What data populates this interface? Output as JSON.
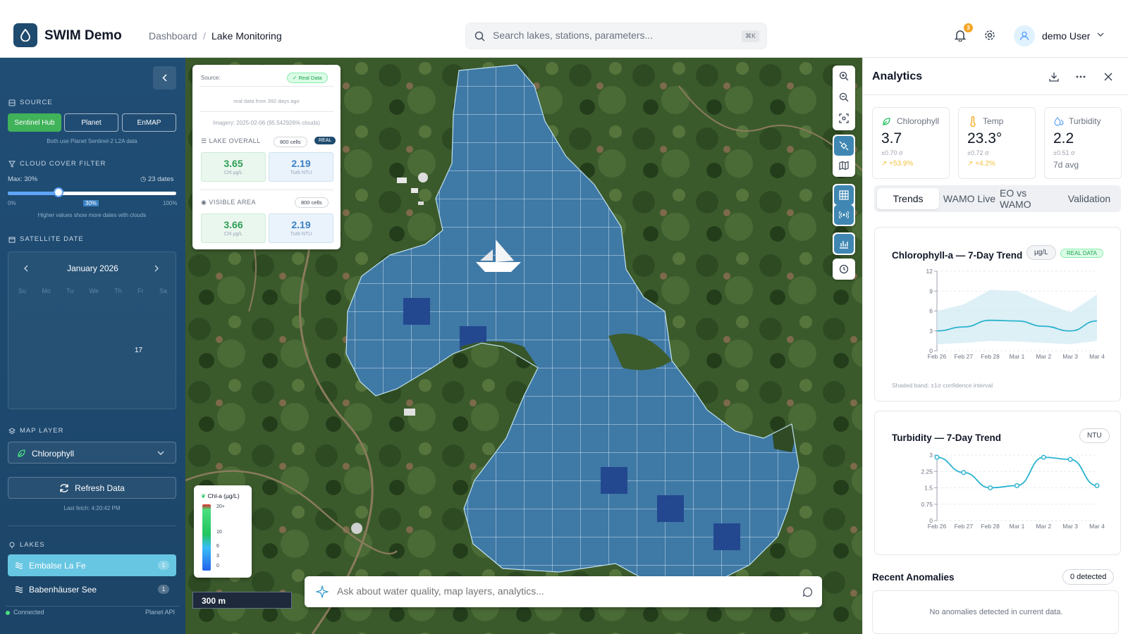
{
  "header": {
    "app_title": "SWIM Demo",
    "breadcrumb": [
      "Dashboard",
      "/",
      "Lake Monitoring"
    ],
    "search_placeholder": "Search lakes, stations, parameters...",
    "search_shortcut": "⌘K",
    "notification_count": "3",
    "user_name": "demo User"
  },
  "sidebar": {
    "source_title": "SOURCE",
    "sources": [
      "Sentinel Hub",
      "Planet",
      "EnMAP"
    ],
    "source_note": "Both use Planet Sentinel-2 L2A data",
    "cloud_title": "CLOUD COVER FILTER",
    "cloud_max": "Max: 30%",
    "cloud_dates": "23 dates",
    "cloud_value": 30,
    "slider_min": "0%",
    "slider_mid": "30%",
    "slider_max": "100%",
    "cloud_hint": "Higher values show more dates with clouds",
    "sat_title": "SATELLITE DATE",
    "month": "January 2026",
    "weekdays": [
      "Su",
      "Mo",
      "Tu",
      "We",
      "Th",
      "Fr",
      "Sa"
    ],
    "highlight_day": "17",
    "layer_title": "MAP LAYER",
    "layer_value": "Chlorophyll",
    "refresh_label": "Refresh Data",
    "last_fetch": "Last fetch: 4:20:42 PM",
    "lakes_title": "LAKES",
    "lakes": [
      {
        "name": "Embalse La Fe",
        "count": "1"
      },
      {
        "name": "Babenhäuser See",
        "count": "1"
      }
    ],
    "status": "Connected",
    "api": "Planet API"
  },
  "map": {
    "source_label": "Source:",
    "real_badge": "✓ Real Data",
    "real_note": "real data from 392 days ago",
    "imagery": "Imagery: 2025-02-06 (95.542926% clouds)",
    "lake_overall": "LAKE OVERALL",
    "cells": "800 cells",
    "real_tag": "REAL",
    "overall_chl": "3.65",
    "overall_turb": "2.19",
    "chl_unit": "Chl µg/L",
    "turb_unit": "Turb NTU",
    "visible_area": "VISIBLE AREA",
    "visible_cells": "800 cells",
    "visible_chl": "3.66",
    "visible_turb": "2.19",
    "legend_title": "Chl-a (µg/L)",
    "legend_ticks": [
      "20+",
      "10",
      "6",
      "3",
      "0"
    ],
    "scale": "300 m",
    "ask_placeholder": "Ask about water quality, map layers, analytics..."
  },
  "analytics": {
    "title": "Analytics",
    "kpis": [
      {
        "label": "Chlorophyll",
        "value": "3.7",
        "sigma": "±0.70 σ",
        "delta": "↗ +53.9%"
      },
      {
        "label": "Temp",
        "value": "23.3°",
        "sigma": "±0.72 σ",
        "delta": "↗ +4.2%"
      },
      {
        "label": "Turbidity",
        "value": "2.2",
        "sigma": "±0.51 σ",
        "delta": "7d avg"
      }
    ],
    "tabs": [
      "Trends",
      "WAMO Live",
      "EO vs WAMO",
      "Validation"
    ],
    "chl_title": "Chlorophyll-a — 7-Day Trend",
    "chl_unit": "µg/L",
    "chl_badge": "REAL DATA",
    "chl_footnote": "Shaded band: ±1σ confidence interval",
    "turb_title": "Turbidity — 7-Day Trend",
    "turb_unit": "NTU",
    "anomalies_title": "Recent Anomalies",
    "anomalies_count": "0 detected",
    "anomalies_empty": "No anomalies detected in current data."
  },
  "chart_data": [
    {
      "type": "area",
      "title": "Chlorophyll-a — 7-Day Trend",
      "categories": [
        "Feb 26",
        "Feb 27",
        "Feb 28",
        "Mar 1",
        "Mar 2",
        "Mar 3",
        "Mar 4"
      ],
      "series": [
        {
          "values": [
            3.0,
            3.6,
            4.6,
            4.5,
            3.7,
            3.0,
            4.5
          ]
        },
        {
          "values": [
            6.0,
            7.0,
            9.2,
            9.0,
            7.3,
            5.8,
            8.5
          ]
        },
        {
          "values": [
            1.0,
            1.2,
            1.5,
            1.4,
            1.2,
            1.0,
            1.5
          ]
        }
      ],
      "yticks": [
        0,
        3,
        6,
        9,
        12
      ],
      "ylim": [
        0,
        12
      ]
    },
    {
      "type": "line",
      "title": "Turbidity — 7-Day Trend",
      "categories": [
        "Feb 26",
        "Feb 27",
        "Feb 28",
        "Mar 1",
        "Mar 2",
        "Mar 3",
        "Mar 4"
      ],
      "series": [
        {
          "values": [
            2.9,
            2.2,
            1.5,
            1.6,
            2.9,
            2.8,
            1.6
          ]
        }
      ],
      "yticks": [
        0,
        0.75,
        1.5,
        2.25,
        3
      ],
      "ylim": [
        0,
        3
      ]
    }
  ]
}
